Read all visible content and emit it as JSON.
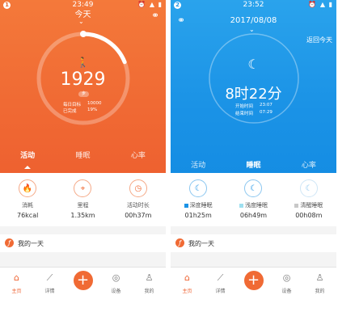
{
  "left": {
    "status_badge": "1",
    "status_time": "23:49",
    "title": "今天",
    "steps": "1929",
    "pill": "步",
    "goal_label": "每日目标",
    "goal_value": "10000",
    "done_label": "已完成",
    "done_value": "19%",
    "progress_fraction": 0.19,
    "tabs": [
      "活动",
      "睡眠",
      "心率"
    ],
    "stats": [
      {
        "label": "消耗",
        "value": "76kcal"
      },
      {
        "label": "里程",
        "value": "1.35km"
      },
      {
        "label": "活动时长",
        "value": "00h37m"
      }
    ],
    "my_day": "我的一天"
  },
  "right": {
    "status_badge": "2",
    "status_time": "23:52",
    "date": "2017/08/08",
    "back_today": "返回今天",
    "sleep_total": "8时22分",
    "start_label": "开始时间",
    "start_value": "23:07",
    "end_label": "结束时间",
    "end_value": "07:29",
    "tabs": [
      "活动",
      "睡眠",
      "心率"
    ],
    "stats": [
      {
        "label": "深度睡眠",
        "value": "01h25m"
      },
      {
        "label": "浅度睡眠",
        "value": "06h49m"
      },
      {
        "label": "清醒睡眠",
        "value": "00h08m"
      }
    ],
    "my_day": "我的一天"
  },
  "tabbar": [
    "主页",
    "详情",
    "",
    "设备",
    "我的"
  ],
  "colors": {
    "orange": "#f06a34",
    "blue": "#1b93e6",
    "deep": "#1b93e6",
    "light": "#9fe0f0",
    "awake": "#c8c8c8"
  }
}
